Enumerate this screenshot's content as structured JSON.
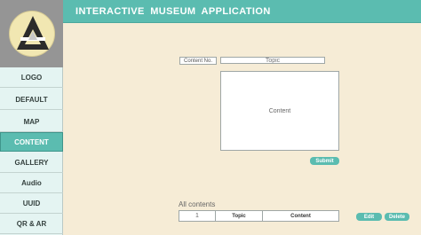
{
  "header": {
    "title": "INTERACTIVE  MUSEUM  APPLICATION"
  },
  "sidebar": {
    "logo_icon": "triangle-a-logo",
    "items": [
      {
        "label": "LOGO"
      },
      {
        "label": "DEFAULT"
      },
      {
        "label": "MAP"
      },
      {
        "label": "CONTENT",
        "active": true
      },
      {
        "label": "GALLERY"
      },
      {
        "label": "Audio"
      },
      {
        "label": "UUID"
      },
      {
        "label": "QR & AR"
      }
    ]
  },
  "form": {
    "content_no_label": "Content No.",
    "topic_placeholder": "Topic",
    "content_placeholder": "Content",
    "submit_label": "Submit"
  },
  "list": {
    "title": "All contents",
    "rows": [
      {
        "no": "1",
        "topic": "Topic",
        "content": "Content"
      }
    ],
    "edit_label": "Edit",
    "delete_label": "Delete"
  },
  "colors": {
    "accent": "#5bbcb0",
    "background": "#f6ecd6",
    "sidebar": "#e4f4f2"
  }
}
